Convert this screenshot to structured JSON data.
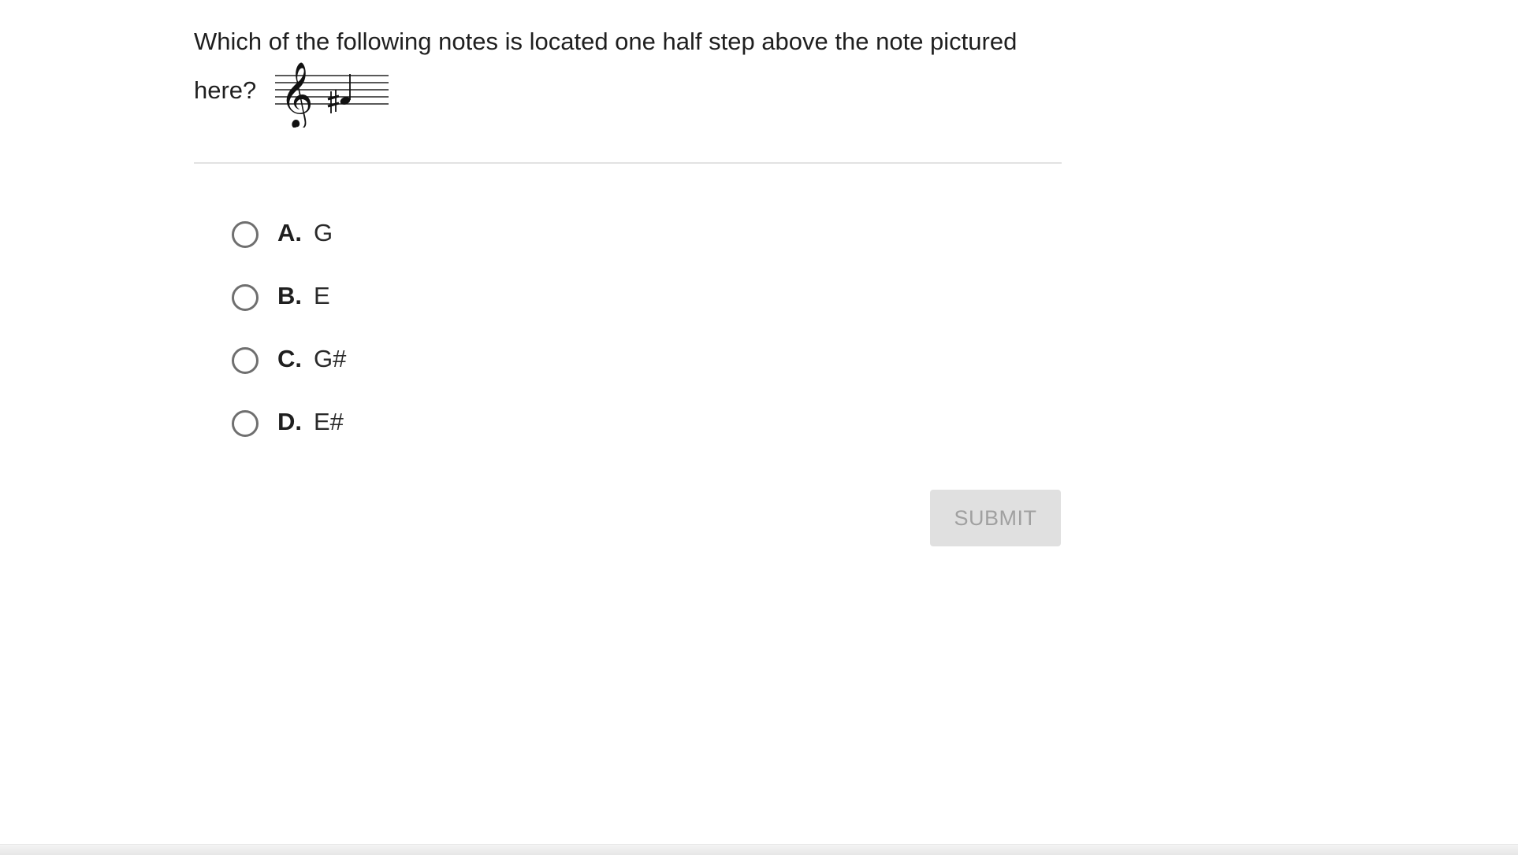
{
  "question": {
    "line1": "Which of the following notes is located one half step above the note pictured",
    "line2": "here?",
    "image_icon": "treble-clef-staff-f-sharp-note"
  },
  "choices": [
    {
      "letter": "A.",
      "text": "G"
    },
    {
      "letter": "B.",
      "text": "E"
    },
    {
      "letter": "C.",
      "text": "G#"
    },
    {
      "letter": "D.",
      "text": "E#"
    }
  ],
  "submit": {
    "label": "SUBMIT",
    "state": "disabled"
  },
  "colors": {
    "text": "#1f1f1f",
    "radio_border": "#6f6f6f",
    "divider": "#e2e2e2",
    "submit_bg": "#e0e0e0",
    "submit_text": "#a0a0a0"
  }
}
